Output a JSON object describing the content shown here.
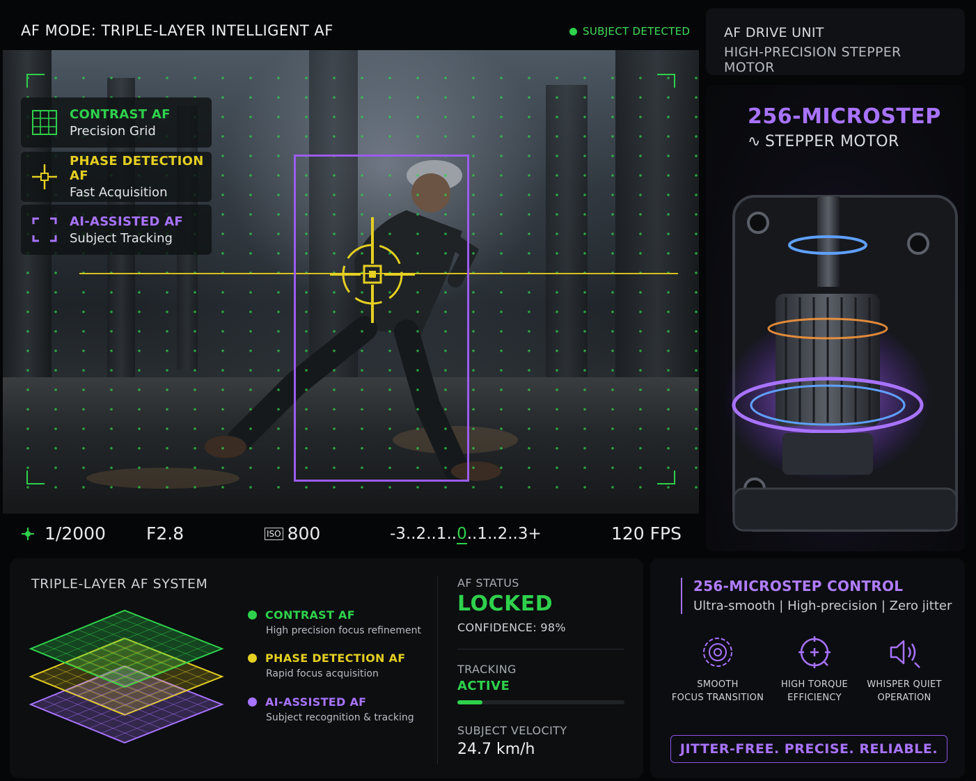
{
  "colors": {
    "green": "#2fd14c",
    "yellow": "#e5cf22",
    "purple": "#a873ff",
    "panel": "#0c0e10"
  },
  "viewfinder": {
    "mode_title": "AF MODE: TRIPLE-LAYER INTELLIGENT AF",
    "subject_status": "SUBJECT DETECTED",
    "modes": [
      {
        "title": "CONTRAST AF",
        "subtitle": "Precision Grid",
        "icon": "grid-icon"
      },
      {
        "title": "PHASE DETECTION AF",
        "subtitle": "Fast Acquisition",
        "icon": "crosshair-icon"
      },
      {
        "title": "AI-ASSISTED AF",
        "subtitle": "Subject Tracking",
        "icon": "focus-frame-icon"
      }
    ]
  },
  "exposure": {
    "shutter": "1/2000",
    "aperture": "F2.8",
    "iso_label": "ISO",
    "iso_value": "800",
    "ev_scale_left": "-3..2..1..",
    "ev_scale_zero": "0",
    "ev_scale_right": "..1..2..3+",
    "fps": "120 FPS"
  },
  "drive_unit": {
    "title": "AF DRIVE UNIT",
    "subtitle": "HIGH-PRECISION STEPPER MOTOR"
  },
  "motor": {
    "headline": "256-MICROSTEP",
    "subline": "STEPPER MOTOR"
  },
  "af_system": {
    "title": "TRIPLE-LAYER AF SYSTEM",
    "legend": [
      {
        "name": "CONTRAST AF",
        "desc": "High precision focus refinement"
      },
      {
        "name": "PHASE DETECTION AF",
        "desc": "Rapid focus acquisition"
      },
      {
        "name": "AI-ASSISTED AF",
        "desc": "Subject recognition & tracking"
      }
    ]
  },
  "af_status": {
    "label": "AF STATUS",
    "value": "LOCKED",
    "confidence": "CONFIDENCE: 98%",
    "tracking_label": "TRACKING",
    "tracking_value": "ACTIVE",
    "tracking_level": 0.15,
    "velocity_label": "SUBJECT VELOCITY",
    "velocity_value": "24.7 km/h"
  },
  "microstep": {
    "title": "256-MICROSTEP CONTROL",
    "subtitle": "Ultra-smooth | High-precision | Zero jitter",
    "features": [
      {
        "line1": "SMOOTH",
        "line2": "FOCUS TRANSITION",
        "icon": "smooth-focus-icon"
      },
      {
        "line1": "HIGH TORQUE",
        "line2": "EFFICIENCY",
        "icon": "torque-icon"
      },
      {
        "line1": "WHISPER QUIET",
        "line2": "OPERATION",
        "icon": "speaker-quiet-icon"
      }
    ],
    "tagline": "JITTER-FREE. PRECISE. RELIABLE."
  }
}
